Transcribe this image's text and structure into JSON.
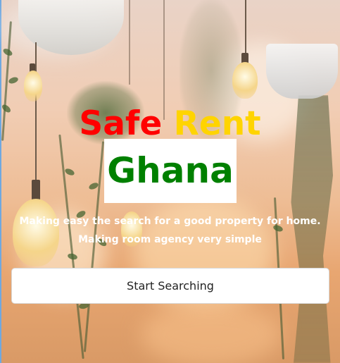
{
  "hero": {
    "title_word1": "Safe",
    "title_word2": "Rent",
    "title_word3": "Ghana",
    "tagline_line1": "Making easy the search for a good property for home.",
    "tagline_line2": "Making room agency very simple",
    "cta_label": "Start Searching"
  },
  "colors": {
    "safe": "#ff0000",
    "rent": "#ffd400",
    "ghana": "#008000",
    "tagline": "#ffffff",
    "button_bg": "#ffffff"
  },
  "background": {
    "description_icon": "hanging-plants-and-lamps-photo"
  }
}
